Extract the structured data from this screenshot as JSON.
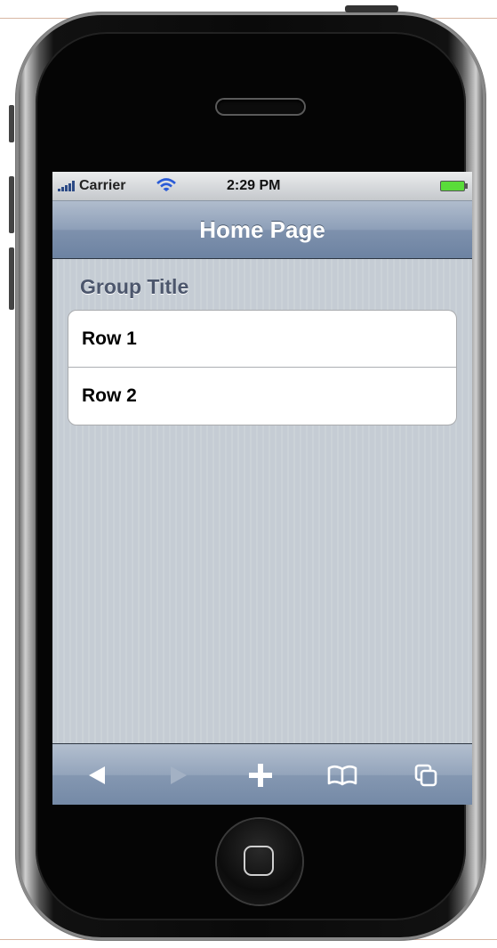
{
  "status_bar": {
    "carrier": "Carrier",
    "time": "2:29 PM",
    "signal_icon": "signal-bars-icon",
    "wifi_icon": "wifi-icon",
    "battery_icon": "battery-icon",
    "battery_color": "#5adc3a"
  },
  "nav_bar": {
    "title": "Home Page"
  },
  "group": {
    "title": "Group Title",
    "rows": [
      {
        "label": "Row 1"
      },
      {
        "label": "Row 2"
      }
    ]
  },
  "toolbar": {
    "items": [
      {
        "icon": "back-arrow-icon",
        "enabled": true
      },
      {
        "icon": "forward-arrow-icon",
        "enabled": false
      },
      {
        "icon": "add-plus-icon",
        "enabled": true
      },
      {
        "icon": "bookmarks-book-icon",
        "enabled": true
      },
      {
        "icon": "pages-icon",
        "enabled": true
      }
    ]
  },
  "colors": {
    "nav_bar": "#7e91ad",
    "background_stripes": "#c5ccd4",
    "group_title": "#4c566c"
  }
}
